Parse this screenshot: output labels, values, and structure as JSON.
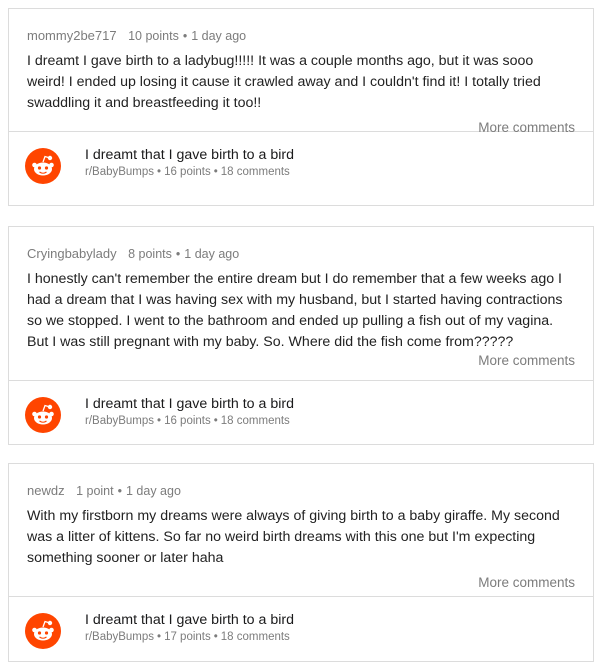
{
  "comments": [
    {
      "username": "mommy2be717",
      "points": "10 points",
      "age": "1 day ago",
      "text": "I dreamt I gave birth to a ladybug!!!!! It was a couple months ago, but it was sooo weird! I ended up losing it cause it crawled away and I couldn't find it! I totally tried swaddling it and breastfeeding it too!!",
      "more_label": "More comments",
      "post": {
        "title": "I dreamt that I gave birth to a bird",
        "subreddit": "r/BabyBumps",
        "points": "16 points",
        "comments": "18 comments",
        "icon": "reddit-alien-icon"
      }
    },
    {
      "username": "Cryingbabylady",
      "points": "8 points",
      "age": "1 day ago",
      "text": "I honestly can't remember the entire dream but I do remember that a few weeks ago I had a dream that I was having sex with my husband, but I started having contractions so we stopped. I went to the bathroom and ended up pulling a fish out of my vagina. But I was still pregnant with my baby. So. Where did the fish come from?????",
      "more_label": "More comments",
      "post": {
        "title": "I dreamt that I gave birth to a bird",
        "subreddit": "r/BabyBumps",
        "points": "16 points",
        "comments": "18 comments",
        "icon": "reddit-alien-icon"
      }
    },
    {
      "username": "newdz",
      "points": "1 point",
      "age": "1 day ago",
      "text": "With my firstborn my dreams were always of giving birth to a baby giraffe. My second was a litter of kittens. So far no weird birth dreams with this one but I'm expecting something sooner or later haha",
      "more_label": "More comments",
      "post": {
        "title": "I dreamt that I gave birth to a bird",
        "subreddit": "r/BabyBumps",
        "points": "17 points",
        "comments": "18 comments",
        "icon": "reddit-alien-icon"
      }
    }
  ],
  "colors": {
    "reddit_orange": "#ff4500",
    "meta_gray": "#7c7c7c",
    "border": "#dcdcdc"
  }
}
